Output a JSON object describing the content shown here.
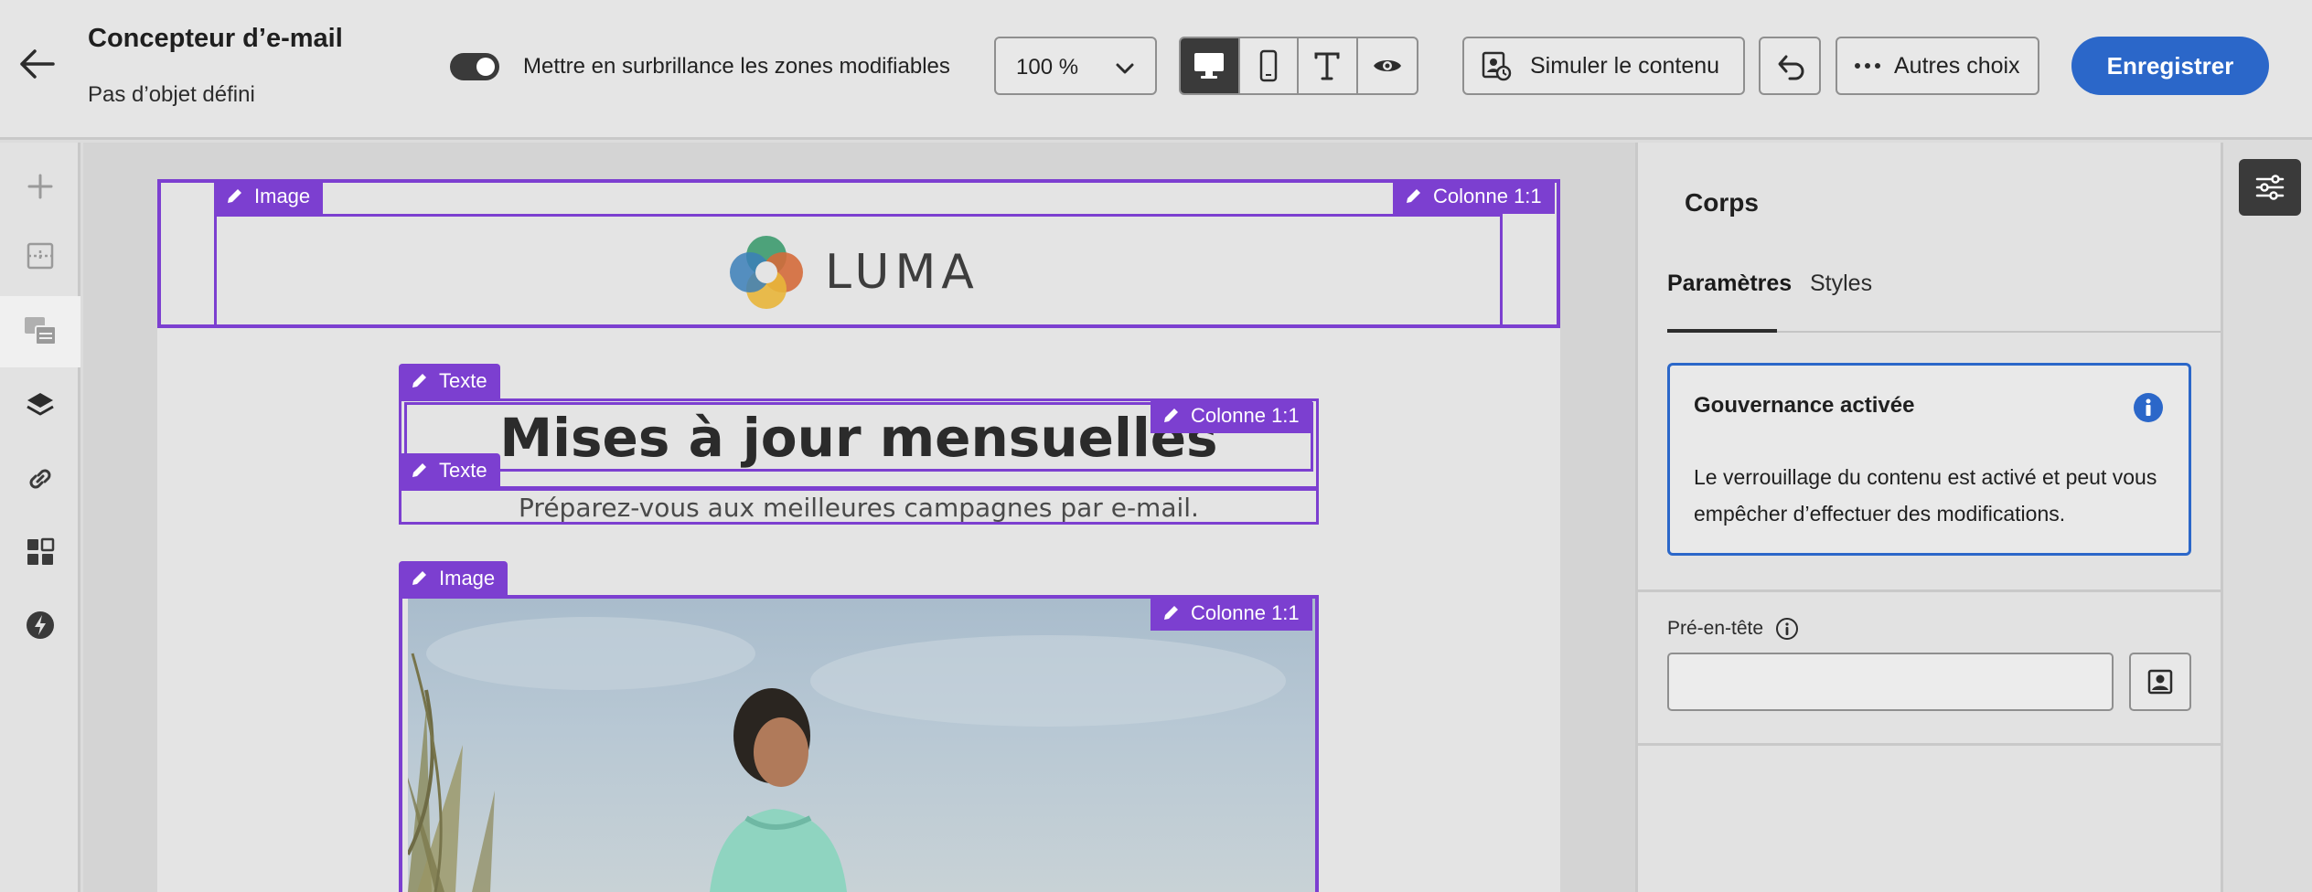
{
  "header": {
    "title": "Concepteur d’e-mail",
    "subtitle": "Pas d’objet défini",
    "highlight_toggle_label": "Mettre en surbrillance les zones modifiables",
    "highlight_toggle_on": true,
    "zoom_value": "100 %",
    "view_modes": [
      "desktop",
      "mobile",
      "text",
      "preview"
    ],
    "active_view": "desktop",
    "simulate_label": "Simuler le contenu",
    "more_label": "Autres choix",
    "save_label": "Enregistrer"
  },
  "left_rail": {
    "icons": [
      "add-icon",
      "structure-icon",
      "fragments-icon",
      "layers-icon",
      "links-icon",
      "components-icon",
      "assets-icon"
    ],
    "active": "layers-icon"
  },
  "canvas": {
    "header_image_tag": "Image",
    "column_tag": "Colonne 1:1",
    "logo_text": "LUMA",
    "text_tag": "Texte",
    "headline": "Mises à jour mensuelles",
    "subheadline": "Préparez-vous aux meilleures campagnes par e-mail.",
    "hero_image_tag": "Image"
  },
  "right_panel": {
    "title": "Corps",
    "tabs": [
      "Paramètres",
      "Styles"
    ],
    "active_tab": "Paramètres",
    "governance": {
      "title": "Gouvernance activée",
      "body": "Le verrouillage du contenu est activé et peut vous empêcher d’effectuer des modifications."
    },
    "preheader": {
      "label": "Pré-en-tête",
      "value": ""
    }
  },
  "colors": {
    "accent_purple": "#7c3fd0",
    "primary_blue": "#2b67c9",
    "toggle_dark": "#3a3a3a"
  }
}
